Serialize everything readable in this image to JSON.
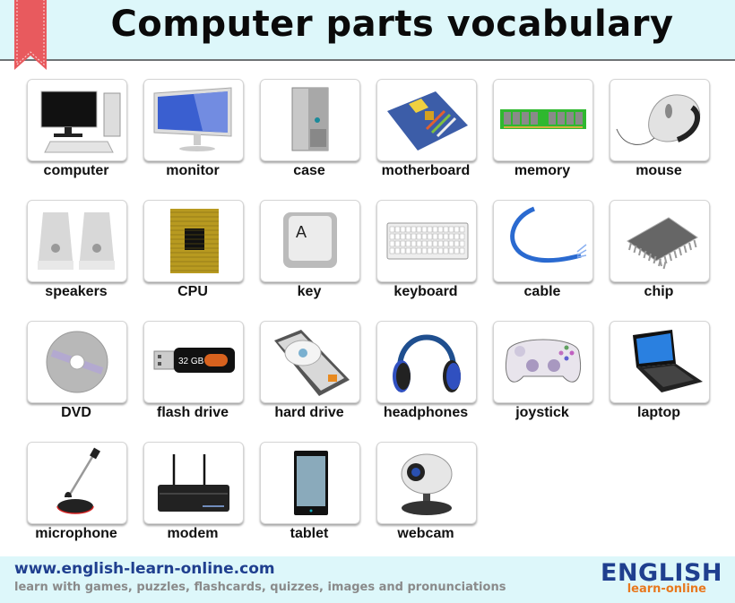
{
  "header": {
    "title": "Computer parts vocabulary",
    "ribbon_color": "#e85a5e"
  },
  "items": [
    {
      "label": "computer",
      "icon": "computer-icon"
    },
    {
      "label": "monitor",
      "icon": "monitor-icon"
    },
    {
      "label": "case",
      "icon": "case-icon"
    },
    {
      "label": "motherboard",
      "icon": "motherboard-icon"
    },
    {
      "label": "memory",
      "icon": "memory-icon"
    },
    {
      "label": "mouse",
      "icon": "mouse-icon"
    },
    {
      "label": "speakers",
      "icon": "speakers-icon"
    },
    {
      "label": "CPU",
      "icon": "cpu-icon"
    },
    {
      "label": "key",
      "icon": "key-icon",
      "key_char": "A"
    },
    {
      "label": "keyboard",
      "icon": "keyboard-icon"
    },
    {
      "label": "cable",
      "icon": "cable-icon"
    },
    {
      "label": "chip",
      "icon": "chip-icon"
    },
    {
      "label": "DVD",
      "icon": "dvd-icon"
    },
    {
      "label": "flash drive",
      "icon": "flash-drive-icon",
      "capacity": "32 GB"
    },
    {
      "label": "hard drive",
      "icon": "hard-drive-icon"
    },
    {
      "label": "headphones",
      "icon": "headphones-icon"
    },
    {
      "label": "joystick",
      "icon": "joystick-icon"
    },
    {
      "label": "laptop",
      "icon": "laptop-icon"
    },
    {
      "label": "microphone",
      "icon": "microphone-icon"
    },
    {
      "label": "modem",
      "icon": "modem-icon"
    },
    {
      "label": "tablet",
      "icon": "tablet-icon"
    },
    {
      "label": "webcam",
      "icon": "webcam-icon"
    }
  ],
  "footer": {
    "url": "www.english-learn-online.com",
    "tagline": "learn with games, puzzles, flashcards, quizzes, images and pronunciations",
    "logo_main": "ENGLISH",
    "logo_sub": "learn-online",
    "colors": {
      "blue": "#1f3f8f",
      "orange": "#e8781e",
      "gray": "#8a8a8a"
    }
  }
}
